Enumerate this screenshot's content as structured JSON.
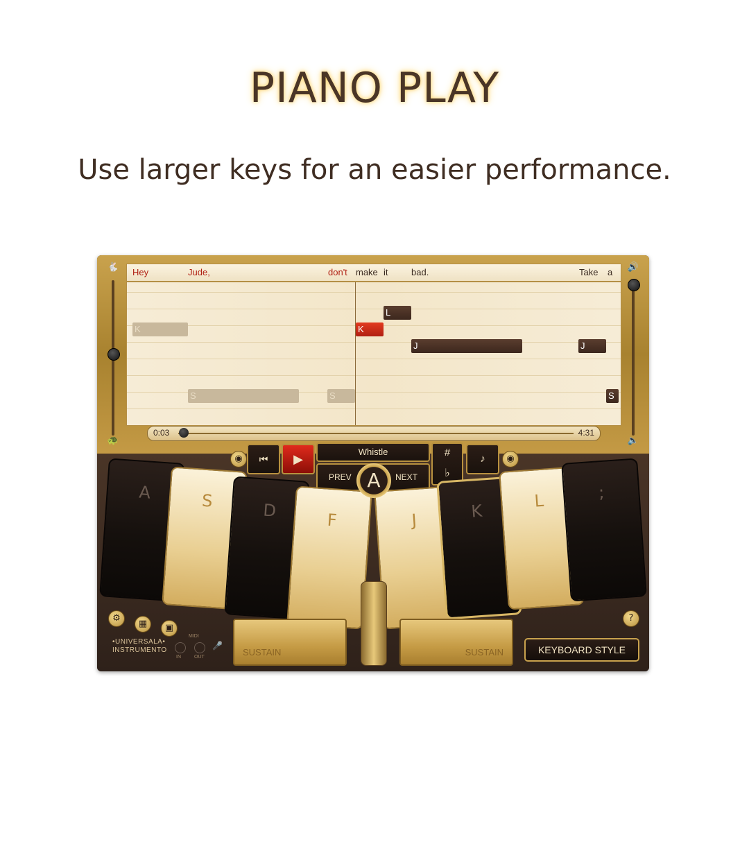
{
  "promo": {
    "title": "PIANO PLAY",
    "subtitle": "Use larger keys for an easier performance."
  },
  "lyrics": [
    {
      "text": "Hey",
      "highlight": true
    },
    {
      "text": "Jude,",
      "highlight": true
    },
    {
      "text": "don't",
      "highlight": true
    },
    {
      "text": "make",
      "highlight": false
    },
    {
      "text": "it",
      "highlight": false
    },
    {
      "text": "bad.",
      "highlight": false
    },
    {
      "text": "Take",
      "highlight": false
    },
    {
      "text": "a",
      "highlight": false
    }
  ],
  "notes": [
    "K",
    "S",
    "S",
    "K",
    "L",
    "J",
    "J",
    "S"
  ],
  "progress": {
    "current": "0:03",
    "total": "4:31",
    "fraction": 0.01
  },
  "controls": {
    "instrument": "Whistle",
    "prev_label": "PREV",
    "next_label": "NEXT",
    "medal_letter": "A",
    "sharp": "#",
    "flat": "♭"
  },
  "keys": [
    "A",
    "S",
    "D",
    "F",
    "J",
    "K",
    "L",
    ";"
  ],
  "sustain_label": "SUSTAIN",
  "keyboard_style_label": "KEYBOARD STYLE",
  "brand": {
    "line1": "•UNIVERSALA•",
    "line2": "INSTRUMENTO"
  },
  "midi": {
    "label": "MIDI",
    "in": "IN",
    "out": "OUT"
  },
  "help": "?",
  "colors": {
    "gold": "#c9a24d",
    "dark_brown": "#2b1d16",
    "red": "#b01f12",
    "cream": "#f6ecd6"
  }
}
